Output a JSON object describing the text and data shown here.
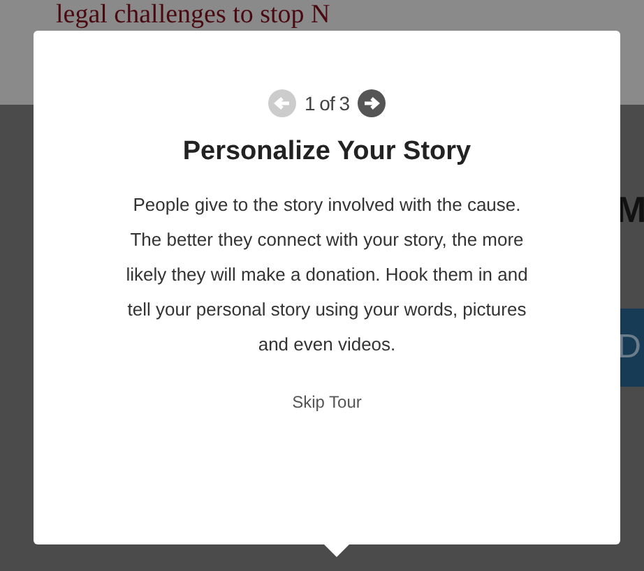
{
  "background_page": {
    "headline": "legal challenges to stop N",
    "side_heading": "M",
    "side_button": "D"
  },
  "tour_popup": {
    "pager": {
      "label": "1 of 3",
      "prev_disabled": true,
      "next_disabled": false
    },
    "title": "Personalize Your Story",
    "body": "People give to the story involved with the cause. The better they connect with your story, the more likely they will make a donation. Hook them in and tell your personal story using your words, pictures and even videos.",
    "skip_link": "Skip Tour"
  }
}
